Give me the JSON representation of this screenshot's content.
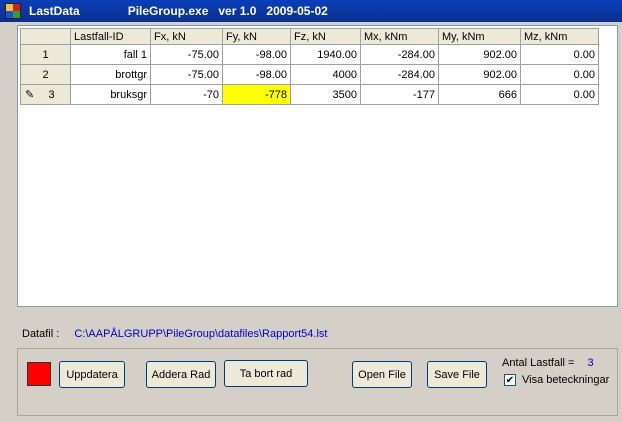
{
  "window": {
    "title": "LastData",
    "info": "PileGroup.exe   ver 1.0   2009-05-02"
  },
  "grid": {
    "columns": [
      "Lastfall-ID",
      "Fx, kN",
      "Fy, kN",
      "Fz, kN",
      "Mx, kNm",
      "My, kNm",
      "Mz, kNm"
    ],
    "rows": [
      {
        "num": "1",
        "cells": [
          "fall 1",
          "-75.00",
          "-98.00",
          "1940.00",
          "-284.00",
          "902.00",
          "0.00"
        ]
      },
      {
        "num": "2",
        "cells": [
          "brottgr",
          "-75.00",
          "-98.00",
          "4000",
          "-284.00",
          "902.00",
          "0.00"
        ]
      },
      {
        "num": "3",
        "cells": [
          "bruksgr",
          "-70",
          "-778",
          "3500",
          "-177",
          "666",
          "0.00"
        ]
      }
    ],
    "highlight_color": "#ffff00"
  },
  "datafil": {
    "label": "Datafil :",
    "path": "C:\\AAPÅLGRUPP\\PileGroup\\datafiles\\Rapport54.lst"
  },
  "buttons": {
    "uppdatera": "Uppdatera",
    "addera": "Addera Rad",
    "tabort": "Ta bort rad",
    "open": "Open File",
    "save": "Save File"
  },
  "status": {
    "antal_label": "Antal Lastfall =",
    "antal_value": "3",
    "visa_label": "Visa beteckningar",
    "visa_checked": true
  },
  "colors": {
    "indicator": "#ff0000"
  }
}
